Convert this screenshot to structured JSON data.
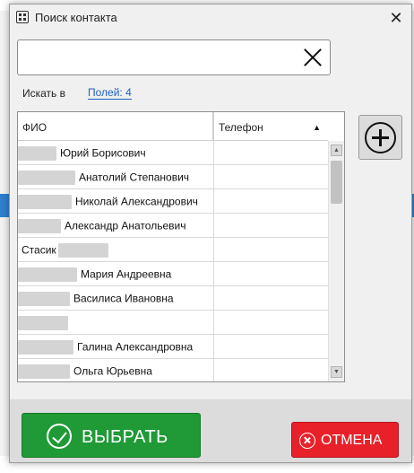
{
  "window": {
    "title": "Поиск контакта",
    "icon": "qr-icon",
    "close_glyph": "✕"
  },
  "search": {
    "value": "",
    "placeholder": ""
  },
  "filter": {
    "search_in_label": "Искать в",
    "fields_link": "Полей: 4"
  },
  "grid": {
    "columns": [
      "ФИО",
      "Телефон"
    ],
    "sort_column": "Телефон",
    "sort_glyph": "▲",
    "rows": [
      {
        "fio": "Юрий Борисович",
        "phone": ""
      },
      {
        "fio": "Анатолий Степанович",
        "phone": ""
      },
      {
        "fio": "Николай Александрович",
        "phone": ""
      },
      {
        "fio": "Александр Анатольевич",
        "phone": ""
      },
      {
        "fio": "Стасик",
        "phone": ""
      },
      {
        "fio": "Мария Андреевна",
        "phone": ""
      },
      {
        "fio": "Василиса Ивановна",
        "phone": ""
      },
      {
        "fio": "",
        "phone": ""
      },
      {
        "fio": "Галина Александровна",
        "phone": ""
      },
      {
        "fio": "Ольга Юрьевна",
        "phone": ""
      }
    ]
  },
  "buttons": {
    "add_icon": "plus-circle-icon",
    "select_label": "ВЫБРАТЬ",
    "cancel_label": "ОТМЕНА"
  },
  "colors": {
    "select_bg": "#1f9a36",
    "cancel_bg": "#e8202a",
    "link": "#1f5fbf"
  }
}
